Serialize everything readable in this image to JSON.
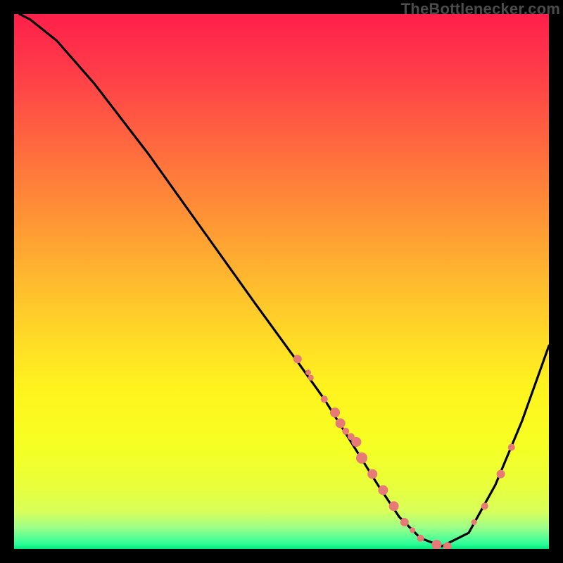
{
  "attribution": "TheBottlenecker.com",
  "colors": {
    "curve_stroke": "#000000",
    "dot_fill": "#e77a77",
    "green": "#00e87a",
    "red": "#ff1f4b",
    "yellow": "#fff31e"
  },
  "chart_data": {
    "type": "line",
    "title": "",
    "xlabel": "",
    "ylabel": "",
    "xlim": [
      0,
      100
    ],
    "ylim": [
      0,
      100
    ],
    "comment": "x is normalized horizontal position (0-100 ≈ left→right of plot); values are normalized height of the curve above the bottom edge (0-100). The curve descends steeply then rises; markers are sample points along the curve.",
    "series": [
      {
        "name": "bottleneck-curve",
        "x": [
          1,
          3,
          8,
          15,
          25,
          35,
          45,
          53,
          58,
          63,
          68,
          72,
          76,
          80,
          85,
          90,
          95,
          100
        ],
        "values": [
          100,
          99,
          95,
          87,
          74,
          60,
          46,
          35,
          28,
          20,
          12,
          6,
          2,
          0.5,
          3,
          12,
          24,
          38
        ]
      }
    ],
    "markers": {
      "name": "sample-dots",
      "x": [
        53,
        55,
        55.5,
        58,
        60,
        61,
        62,
        63,
        64,
        65,
        67,
        69,
        71,
        73,
        74.5,
        76,
        79,
        81,
        86,
        88,
        91,
        93
      ],
      "values": [
        35.5,
        33,
        32,
        28,
        25.5,
        23.5,
        22,
        21,
        20,
        17,
        14,
        11,
        8,
        5,
        3.5,
        2,
        0.8,
        0.5,
        5,
        8,
        14,
        19
      ],
      "r": [
        6,
        4,
        4,
        5,
        7,
        7,
        5,
        5,
        7,
        8,
        7,
        7,
        7,
        6,
        4,
        5,
        7,
        6,
        4,
        5,
        6,
        5
      ]
    }
  }
}
